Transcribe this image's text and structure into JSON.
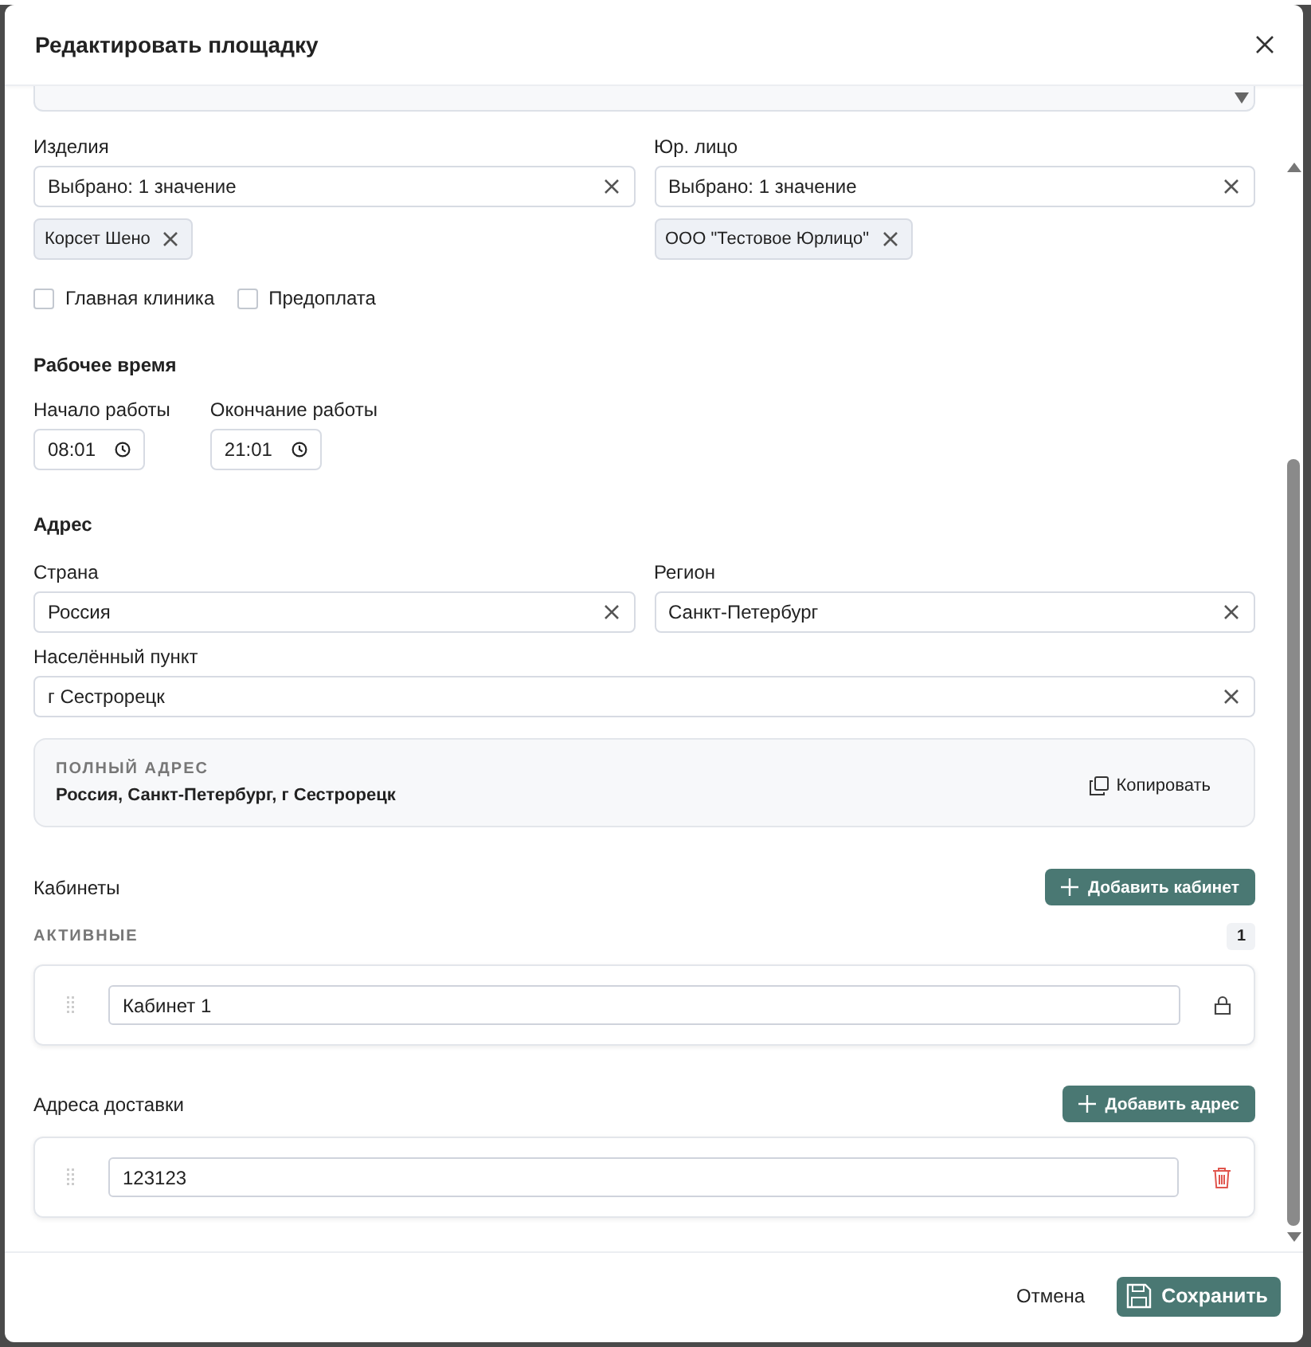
{
  "dialog": {
    "title": "Редактировать площадку"
  },
  "selects": [
    {
      "label": "Изделия",
      "value": "Выбрано: 1 значение",
      "chips": [
        "Корсет Шено"
      ]
    },
    {
      "label": "Юр. лицо",
      "value": "Выбрано: 1 значение",
      "chips": [
        "ООО \"Тестовое Юрлицо\""
      ]
    }
  ],
  "checkboxes": [
    {
      "label": "Главная клиника",
      "checked": false
    },
    {
      "label": "Предоплата",
      "checked": false
    }
  ],
  "work_time": {
    "title": "Рабочее время",
    "fields": [
      {
        "label": "Начало работы",
        "value": "08:01"
      },
      {
        "label": "Окончание работы",
        "value": "21:01"
      }
    ]
  },
  "address": {
    "title": "Адрес",
    "rows": [
      [
        {
          "label": "Страна",
          "value": "Россия"
        },
        {
          "label": "Регион",
          "value": "Санкт-Петербург"
        }
      ],
      [
        {
          "label": "Населённый пункт",
          "value": "г Сестрорецк"
        }
      ]
    ]
  },
  "full_address": {
    "caption": "ПОЛНЫЙ АДРЕС",
    "value": "Россия, Санкт-Петербург, г Сестрорецк",
    "copy_label": "Копировать"
  },
  "cabinets": {
    "title": "Кабинеты",
    "add_label": "Добавить кабинет",
    "group_label": "АКТИВНЫЕ",
    "count": "1",
    "items": [
      {
        "value": "Кабинет 1",
        "kind": "locked"
      }
    ]
  },
  "delivery": {
    "title": "Адреса доставки",
    "add_label": "Добавить адрес",
    "items": [
      {
        "value": "123123",
        "kind": "removable"
      }
    ]
  },
  "footer": {
    "cancel": "Отмена",
    "save": "Сохранить"
  }
}
